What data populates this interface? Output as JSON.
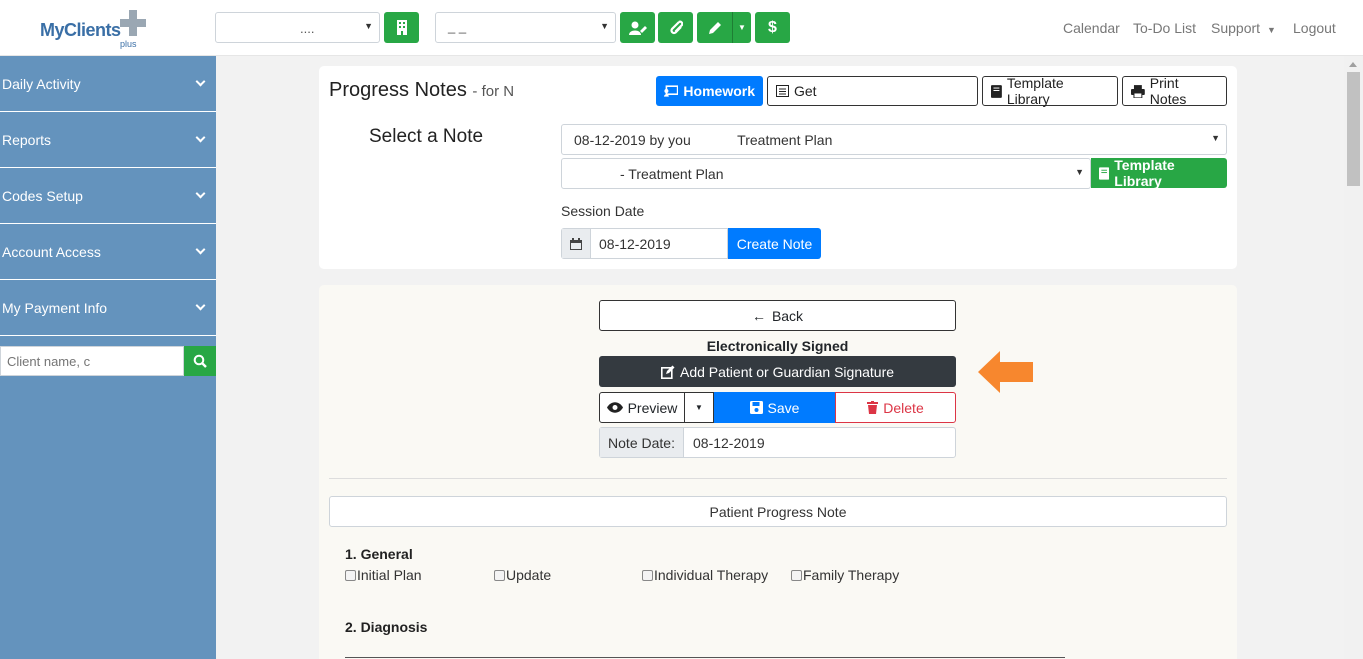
{
  "header": {
    "logo_text": "MyClients",
    "logo_sub": "plus",
    "select1_value": "....",
    "select2_value": "_ _",
    "nav": [
      "Calendar",
      "To-Do List",
      "Support",
      "Logout"
    ]
  },
  "sidebar": {
    "items": [
      {
        "label": "Daily Activity"
      },
      {
        "label": "Reports"
      },
      {
        "label": "Codes Setup"
      },
      {
        "label": "Account Access"
      },
      {
        "label": "My Payment Info"
      }
    ],
    "search_placeholder": "Client name, c"
  },
  "progress": {
    "title": "Progress Notes",
    "subtitle": "- for N",
    "homework_label": "Homework",
    "get_label": "Get",
    "template_library_label": "Template Library",
    "print_label": "Print Notes",
    "select_note_label": "Select a Note",
    "note_select_value": "08-12-2019 by you            Treatment Plan",
    "template_select_value": "- Treatment Plan",
    "template_library_btn": "Template Library",
    "session_date_label": "Session Date",
    "session_date_value": "08-12-2019",
    "create_note_label": "Create Note"
  },
  "note": {
    "back_label": "Back",
    "signed_label": "Electronically Signed",
    "add_signature_label": "Add Patient or Guardian Signature",
    "preview_label": "Preview",
    "save_label": "Save",
    "delete_label": "Delete",
    "note_date_label": "Note Date:",
    "note_date_value": "08-12-2019",
    "form_title": "Patient Progress Note",
    "section1_title": "1. General",
    "section1_options": [
      "Initial Plan",
      "Update",
      "Individual Therapy",
      "Family Therapy"
    ],
    "section2_title": "2. Diagnosis"
  },
  "colors": {
    "sidebar": "#6493bd",
    "green": "#28a745",
    "blue": "#007bff",
    "dark": "#343a40",
    "danger": "#dc3545",
    "arrow": "#f7872e"
  }
}
